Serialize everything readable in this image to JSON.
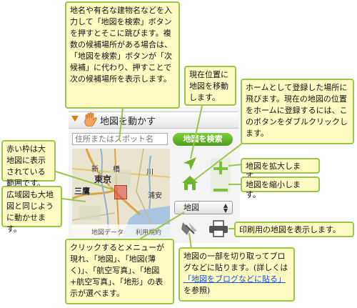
{
  "panel": {
    "title": "地図を動かす",
    "search_placeholder": "住所またはスポット名",
    "search_button": "地図を検索",
    "map_labels": {
      "tokyo": "東京",
      "mitaka": "三鷹",
      "urayasu": "浦安",
      "shinjuku": "新",
      "hashi": "橋",
      "kawa": "川"
    },
    "map_footer_tab1": "地図データ",
    "map_footer_tab2": "利用規約",
    "map_type_selected": "地図",
    "icons": [
      "hand-icon",
      "gps-arrow-icon",
      "home-icon",
      "zoom-in-icon",
      "zoom-out-icon",
      "clip-icon",
      "print-icon"
    ],
    "colors": {
      "accent_green": "#6cb52c",
      "callout_bg": "#fdfbc2",
      "callout_border": "#9bc54a",
      "header_triangle": "#e07a10",
      "frame_red": "#c0392b"
    }
  },
  "callouts": {
    "search": "地名や有名な建物名などを入力して「地図を検索」ボタンを押すとそこに跳びます。複数の候補場所がある場合は、「地図を検索」ボタンが「次候補」に代わり、押すことで次の候補場所を表示します。",
    "location": "現在位置に地図を移動します。",
    "home": "ホームとして登録した場所に飛びます。現在の地図の位置をホームに登録するには、このボタンをダブルクリックします。",
    "red_frame": "赤い枠は大地図に表示されている範囲です。",
    "zoom_in": "地図を拡大します。",
    "zoom_out": "地図を縮小します。",
    "wide_map": "広域図も大地図と同じように動かせます。",
    "map_type": "クリックするとメニューが現れ、「地図」、「地図(薄く)」、「航空写真」、「地図+航空写真」、「地形」の表示が選べます。",
    "print": "印刷用の地図を表示します。",
    "clip_before": "地図の一部を切り取ってブログなどに貼ります。(詳しくは",
    "clip_link": "「地図をブログなどに貼る」",
    "clip_after": "を参照)"
  }
}
